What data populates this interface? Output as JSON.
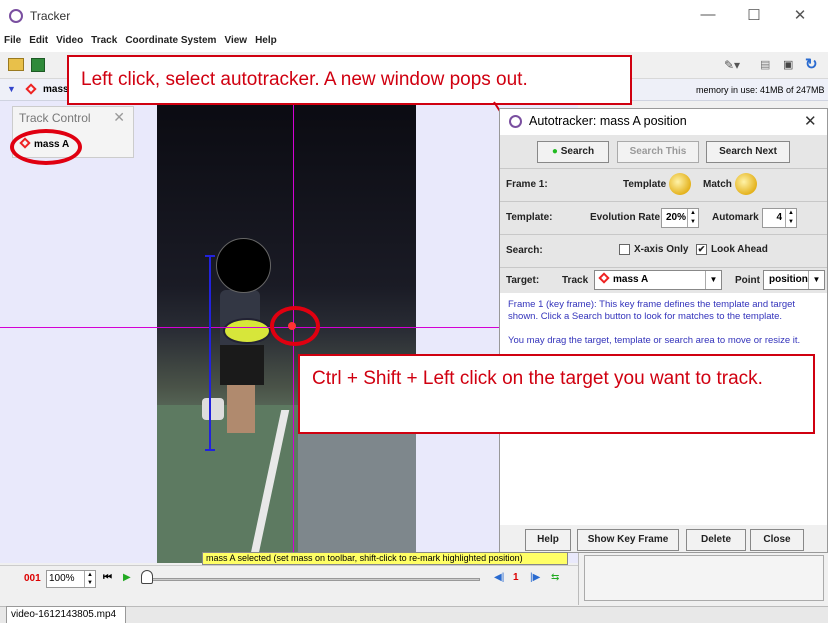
{
  "window": {
    "title": "Tracker",
    "minimize": "—",
    "maximize": "☐",
    "close": "✕"
  },
  "menu": [
    "File",
    "Edit",
    "Video",
    "Track",
    "Coordinate System",
    "View",
    "Help"
  ],
  "trackbar": {
    "track_name": "mass",
    "memory": "memory in use: 41MB of 247MB"
  },
  "track_control": {
    "title": "Track Control",
    "item": "mass A"
  },
  "callouts": {
    "top": "Left click, select autotracker. A new window pops out.",
    "bottom": "Ctrl + Shift + Left click on the target you want to track."
  },
  "autotracker": {
    "title": "Autotracker: mass A position",
    "search": "Search",
    "search_this": "Search This",
    "search_next": "Search Next",
    "frame_label": "Frame 1:",
    "template_label": "Template",
    "match_label": "Match",
    "template_row": "Template:",
    "evolution_rate_label": "Evolution Rate",
    "evolution_rate": "20%",
    "automark_label": "Automark",
    "automark": "4",
    "search_row": "Search:",
    "x_axis_only": "X-axis Only",
    "x_axis_only_checked": false,
    "look_ahead": "Look Ahead",
    "look_ahead_checked": true,
    "target_row": "Target:",
    "track_label": "Track",
    "track_value": "mass A",
    "point_label": "Point",
    "point_value": "position",
    "info_line1": "Frame 1 (key frame): This key frame defines the template and target shown. Click a Search button to look for matches to the template.",
    "info_line2": "You may drag the target, template or search area to move or resize it.",
    "help": "Help",
    "show_key_frame": "Show Key Frame",
    "delete": "Delete",
    "close": "Close"
  },
  "status_note": "mass A selected (set mass on toolbar, shift-click to re-mark highlighted position)",
  "player": {
    "frame": "001",
    "zoom": "100%",
    "step": "1"
  },
  "file_tab": "video-1612143805.mp4",
  "colors": {
    "accent_red": "#d00010",
    "axis_magenta": "#d400d4",
    "axis_blue": "#2222dd"
  }
}
